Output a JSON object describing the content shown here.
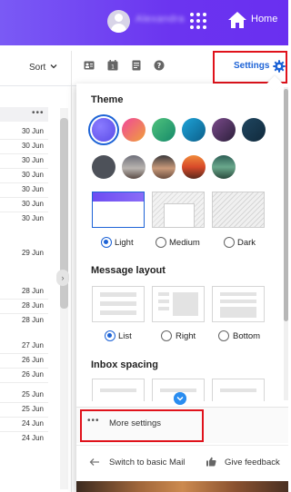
{
  "header": {
    "username": "Alexandra",
    "home_label": "Home",
    "icons": [
      "avatar",
      "apps-grid-icon",
      "home-icon"
    ]
  },
  "toolbar": {
    "sort_label": "Sort",
    "settings_label": "Settings",
    "icons": [
      "contacts-icon",
      "calendar-icon",
      "notepad-icon",
      "help-icon",
      "gear-icon"
    ]
  },
  "list": {
    "dates": [
      "30 Jun",
      "30 Jun",
      "30 Jun",
      "30 Jun",
      "30 Jun",
      "30 Jun",
      "30 Jun",
      "29 Jun",
      "28 Jun",
      "28 Jun",
      "28 Jun",
      "27 Jun",
      "26 Jun",
      "26 Jun",
      "25 Jun",
      "25 Jun",
      "24 Jun",
      "24 Jun"
    ]
  },
  "settings_panel": {
    "theme": {
      "title": "Theme",
      "options": [
        {
          "label": "Light",
          "selected": true
        },
        {
          "label": "Medium",
          "selected": false
        },
        {
          "label": "Dark",
          "selected": false
        }
      ]
    },
    "message_layout": {
      "title": "Message layout",
      "options": [
        {
          "label": "List",
          "selected": true
        },
        {
          "label": "Right",
          "selected": false
        },
        {
          "label": "Bottom",
          "selected": false
        }
      ]
    },
    "inbox_spacing": {
      "title": "Inbox spacing"
    },
    "more_settings_label": "More settings",
    "switch_basic_label": "Switch to basic Mail",
    "feedback_label": "Give feedback"
  },
  "colors": {
    "brand_purple": "#6b34f0",
    "link_blue": "#1d63d6",
    "highlight_red": "#e0121b"
  }
}
